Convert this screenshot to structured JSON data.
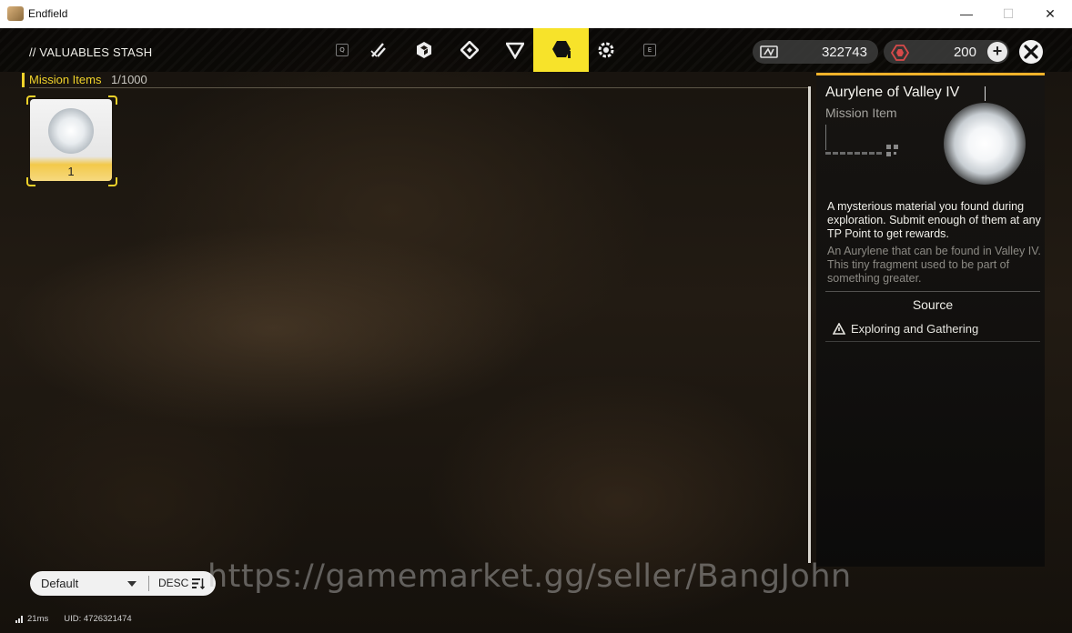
{
  "window": {
    "title": "Endfield"
  },
  "header": {
    "title": "// VALUABLES STASH",
    "tab_prev_key": "Q",
    "tab_next_key": "E",
    "tabs": [
      {
        "icon": "pen-icon",
        "active": false
      },
      {
        "icon": "cube-icon",
        "active": false
      },
      {
        "icon": "diamond-icon",
        "active": false
      },
      {
        "icon": "triangle-icon",
        "active": false
      },
      {
        "icon": "mission-hexagon-icon",
        "active": true
      },
      {
        "icon": "gear-icon",
        "active": false
      }
    ]
  },
  "currencies": [
    {
      "icon": "credit-icon",
      "value": "322743"
    },
    {
      "icon": "origeometry-icon",
      "value": "200"
    }
  ],
  "category": {
    "name": "Mission Items",
    "count": "1/1000"
  },
  "items": [
    {
      "quantity": "1",
      "selected": true
    }
  ],
  "detail": {
    "name": "Aurylene of Valley IV",
    "type": "Mission Item",
    "description": "A mysterious material you found during exploration. Submit enough of them at any TP Point to get rewards.",
    "lore": "An Aurylene that can be found in Valley IV. This tiny fragment used to be part of something greater.",
    "source_heading": "Source",
    "sources": [
      "Exploring and Gathering"
    ]
  },
  "sort": {
    "selected": "Default",
    "direction": "DESC"
  },
  "watermark": "https://gamemarket.gg/seller/BangJohn",
  "status": {
    "ping": "21ms",
    "uid": "UID: 4726321474"
  },
  "colors": {
    "accent": "#f7e32a",
    "panel_top": "#f0b22a"
  }
}
